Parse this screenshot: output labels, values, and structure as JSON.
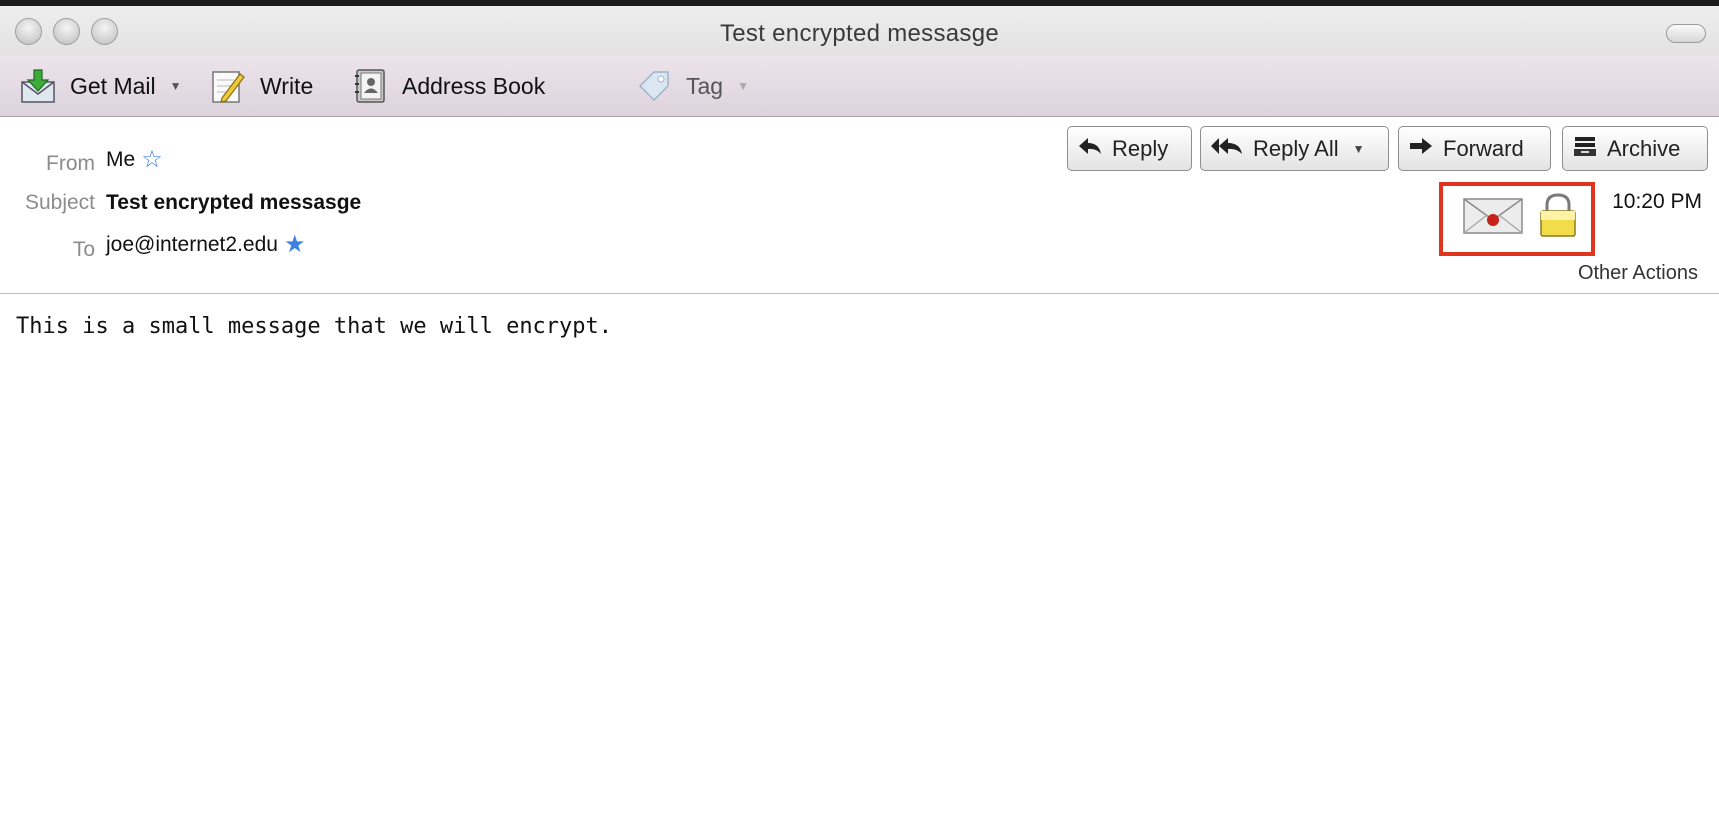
{
  "window": {
    "title": "Test encrypted messasge"
  },
  "toolbar": {
    "get_mail_label": "Get Mail",
    "write_label": "Write",
    "address_book_label": "Address Book",
    "tag_label": "Tag"
  },
  "message": {
    "from_label": "From",
    "from_value": "Me",
    "subject_label": "Subject",
    "subject_value": "Test encrypted messasge",
    "to_label": "To",
    "to_value": "joe@internet2.edu",
    "time": "10:20 PM",
    "body": "This is a small message that we will encrypt."
  },
  "actions": {
    "reply_label": "Reply",
    "reply_all_label": "Reply All",
    "forward_label": "Forward",
    "archive_label": "Archive",
    "other_actions_label": "Other Actions"
  },
  "icons": {
    "signed": "signed-envelope-icon",
    "encrypted": "lock-icon"
  },
  "colors": {
    "highlight_box": "#e0341f",
    "star": "#3d82e2",
    "toolbar_bg": "#e5dce4"
  }
}
